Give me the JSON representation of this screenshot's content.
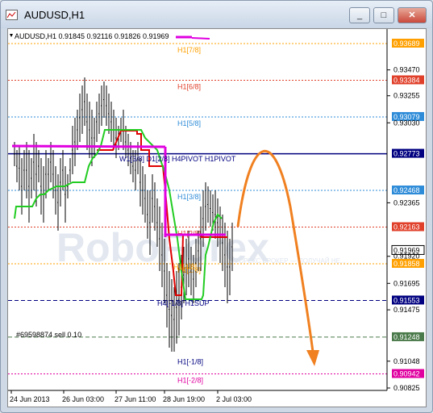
{
  "window": {
    "title": "AUDUSD,H1",
    "min_label": "_",
    "max_label": "□",
    "close_label": "✕"
  },
  "chart": {
    "info": "AUDUSD,H1  0.91845 0.92116 0.91826 0.91969",
    "watermark": "RoboForex",
    "watermark_sub": "ФОРЕКС БРОКЕР — ПОЛУЧАЙ НЕ...",
    "order_label": "#69598874 sell 0.10",
    "annotations": {
      "h4pivot": "W1[3/8] D1[2/8] H4PIVOT H1PIVOT",
      "h1sup": "H4[-1/8] H1SUP",
      "h1_4_8": "H1[4/8]"
    },
    "x_labels": [
      "24 Jun 2013",
      "26 Jun 03:00",
      "27 Jun 11:00",
      "28 Jun 19:00",
      "2 Jul 03:00"
    ],
    "y_ticks": [
      "0.93470",
      "0.93255",
      "0.93030",
      "0.92365",
      "0.91920",
      "0.91695",
      "0.91475",
      "0.91048",
      "0.90825"
    ],
    "levels": [
      {
        "label": "H1[7/8]",
        "price": "0.93689",
        "color": "#ffa000",
        "style": "dotted"
      },
      {
        "label": "H1[6/8]",
        "price": "0.93384",
        "color": "#e0402a",
        "style": "dotted"
      },
      {
        "label": "H1[5/8]",
        "price": "0.93079",
        "color": "#2d8bd8",
        "style": "dotted"
      },
      {
        "label": "",
        "price": "0.92773",
        "color": "#000080",
        "style": "solid"
      },
      {
        "label": "H1[3/8]",
        "price": "0.92468",
        "color": "#2d8bd8",
        "style": "dotted"
      },
      {
        "label": "H1[2/8]",
        "price": "0.92163",
        "color": "#e0402a",
        "style": "dotted"
      },
      {
        "label": "",
        "price": "0.91969",
        "color": "#000000",
        "style": "none"
      },
      {
        "label": "H1[1/8]",
        "price": "0.91858",
        "color": "#ffa000",
        "style": "dotted"
      },
      {
        "label": "",
        "price": "0.91553",
        "color": "#000080",
        "style": "dashed"
      },
      {
        "label": "",
        "price": "0.91248",
        "color": "#4a7a4a",
        "style": "dashed"
      },
      {
        "label": "H1[-1/8]",
        "price": "",
        "color": "#ffffff",
        "style": "none"
      },
      {
        "label": "H1[-2/8]",
        "price": "0.90942",
        "color": "#e000a0",
        "style": "dotted"
      }
    ],
    "colors": {
      "forecast_arrow": "#f08020",
      "pivot_line": "#e000e0",
      "green_line": "#22cc22",
      "red_line": "#e00000"
    }
  }
}
